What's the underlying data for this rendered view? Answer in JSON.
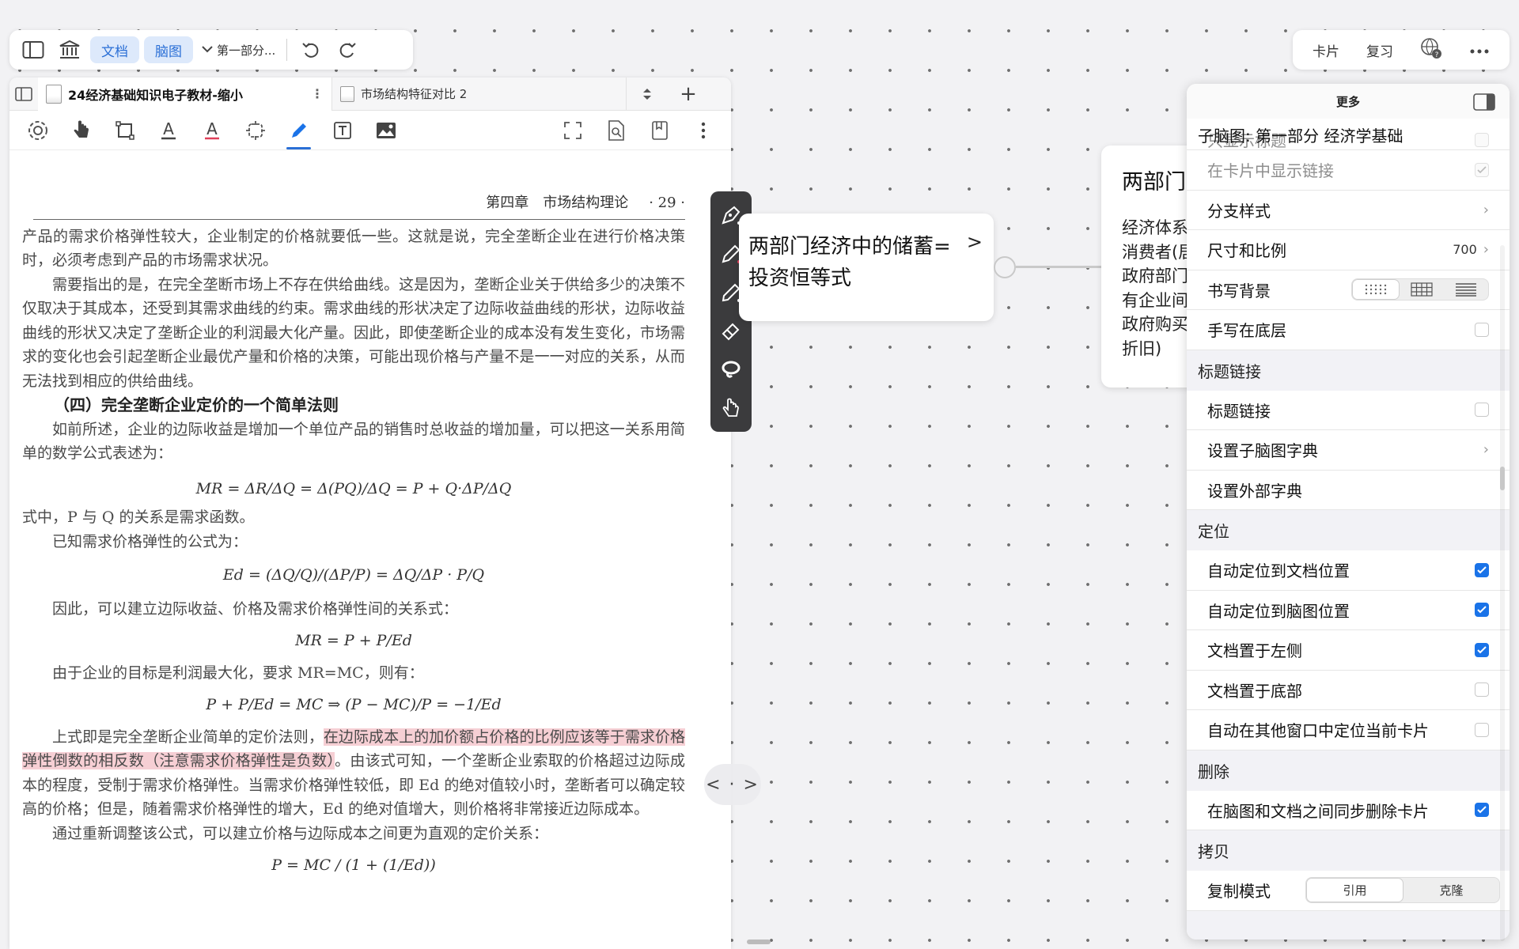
{
  "toolbar": {
    "doc_label": "文档",
    "mindmap_label": "脑图",
    "part_label": "第一部分..."
  },
  "right_toolbar": {
    "card_label": "卡片",
    "review_label": "复习"
  },
  "doc": {
    "tabs": [
      {
        "label": "24经济基础知识电子教材-缩小"
      },
      {
        "label": "市场结构特征对比 2"
      }
    ],
    "page": {
      "header_chapter": "第四章　市场结构理论",
      "page_number": "· 29 ·",
      "p1": "产品的需求价格弹性较大，企业制定的价格就要低一些。这就是说，完全垄断企业在进行价格决策时，必须考虑到产品的市场需求状况。",
      "p2": "需要指出的是，在完全垄断市场上不存在供给曲线。这是因为，垄断企业关于供给多少的决策不仅取决于其成本，还受到其需求曲线的约束。需求曲线的形状决定了边际收益曲线的形状，边际收益曲线的形状又决定了垄断企业的利润最大化产量。因此，即使垄断企业的成本没有发生变化，市场需求的变化也会引起垄断企业最优产量和价格的决策，可能出现价格与产量不是一一对应的关系，从而无法找到相应的供给曲线。",
      "section": "（四）完全垄断企业定价的一个简单法则",
      "p3": "如前所述，企业的边际收益是增加一个单位产品的销售时总收益的增加量，可以把这一关系用简单的数学公式表述为：",
      "f1": "MR = ΔR/ΔQ = Δ(PQ)/ΔQ = P + Q·ΔP/ΔQ",
      "p4": "式中，P 与 Q 的关系是需求函数。",
      "p5": "已知需求价格弹性的公式为：",
      "f2": "Ed = (ΔQ/Q)/(ΔP/P) = ΔQ/ΔP · P/Q",
      "p6": "因此，可以建立边际收益、价格及需求价格弹性间的关系式：",
      "f3": "MR = P + P/Ed",
      "p7": "由于企业的目标是利润最大化，要求 MR=MC，则有：",
      "f4": "P + P/Ed = MC ⇒ (P − MC)/P = −1/Ed",
      "p8_a": "上式即是完全垄断企业简单的定价法则，",
      "p8_hl": "在边际成本上的加价额占价格的比例应该等于需求价格弹性倒数的相反数（注意需求价格弹性是负数）",
      "p8_b": "。由该式可知，一个垄断企业索取的价格超过边际成本的程度，受制于需求价格弹性。当需求价格弹性较低，即 Ed 的绝对值较小时，垄断者可以确定较高的价格；但是，随着需求价格弹性的增大，Ed 的绝对值增大，则价格将非常接近边际成本。",
      "p9": "通过重新调整该公式，可以建立价格与边际成本之间更为直观的定价关系：",
      "f5": "P = MC / (1 + (1/Ed))"
    }
  },
  "nav_pill": "< · >",
  "mindmap": {
    "card_main_title": "两部门经济中的储蓄=投资恒等式",
    "card_second_title": "两部门",
    "card_second_body": [
      "经济体系",
      "消费者(居",
      "政府部门",
      "有企业间",
      "政府购买",
      "折旧)"
    ]
  },
  "more_panel": {
    "title": "更多",
    "subtitle": "子脑图: 第一部分 经济学基础",
    "rows_top": [
      {
        "label": "只显示标题"
      },
      {
        "label": "在卡片中显示链接"
      },
      {
        "label": "分支样式"
      },
      {
        "label": "尺寸和比例",
        "value": "700"
      },
      {
        "label": "书写背景"
      },
      {
        "label": "手写在底层"
      }
    ],
    "group_title_link": "标题链接",
    "rows_link": [
      {
        "label": "标题链接"
      },
      {
        "label": "设置子脑图字典"
      },
      {
        "label": "设置外部字典"
      }
    ],
    "group_locate": "定位",
    "rows_locate": [
      {
        "label": "自动定位到文档位置",
        "checked": true
      },
      {
        "label": "自动定位到脑图位置",
        "checked": true
      },
      {
        "label": "文档置于左侧",
        "checked": true
      },
      {
        "label": "文档置于底部",
        "checked": false
      },
      {
        "label": "自动在其他窗口中定位当前卡片",
        "checked": false
      }
    ],
    "group_delete": "删除",
    "rows_delete": [
      {
        "label": "在脑图和文档之间同步删除卡片",
        "checked": true
      }
    ],
    "group_copy": "拷贝",
    "copy_mode_label": "复制模式",
    "copy_mode_options": [
      "引用",
      "克隆"
    ]
  },
  "colors": {
    "accent": "#1a73e8",
    "highlight": "#f6cfd4",
    "pen_toolbar_bg": "#3b3b3d"
  }
}
